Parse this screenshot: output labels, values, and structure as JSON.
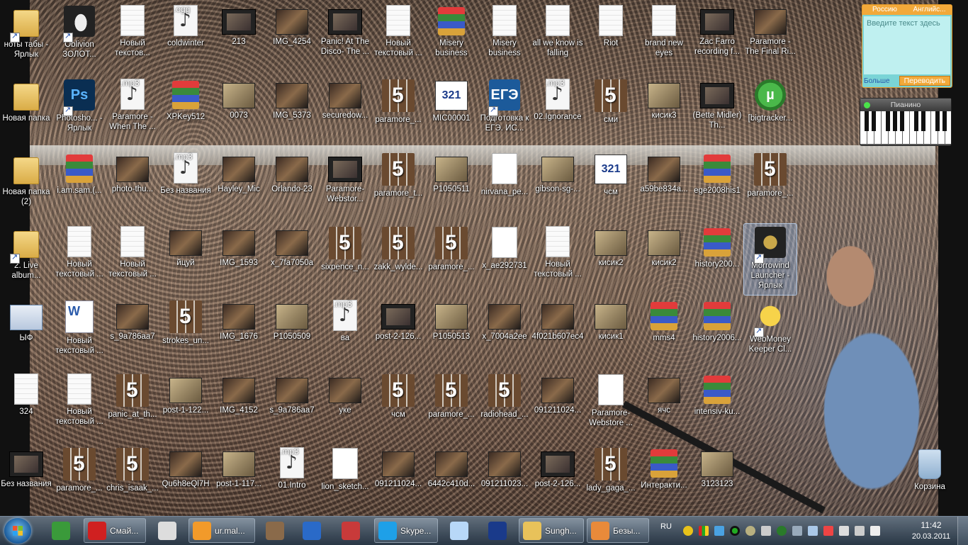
{
  "desktop": {
    "icons": [
      {
        "label": "ноты табы - Ярлык",
        "type": "folder",
        "shortcut": true
      },
      {
        "label": "Oblivion ЗОЛОТ...",
        "type": "obliv",
        "shortcut": true
      },
      {
        "label": "Новый текстов...",
        "type": "doc"
      },
      {
        "label": "coldwinter",
        "type": "mp3",
        "badge": ".ogg"
      },
      {
        "label": "213",
        "type": "vid"
      },
      {
        "label": "IMG_4254",
        "type": "img"
      },
      {
        "label": "Panic! At The Disco- The ...",
        "type": "vid"
      },
      {
        "label": "Новый текстовый ...",
        "type": "doc"
      },
      {
        "label": "Misery business",
        "type": "rar"
      },
      {
        "label": "Misery business",
        "type": "doc"
      },
      {
        "label": "all we know is falling",
        "type": "doc"
      },
      {
        "label": "Riot",
        "type": "doc"
      },
      {
        "label": "brand new eyes",
        "type": "doc"
      },
      {
        "label": "Zac Farro recording f...",
        "type": "vid"
      },
      {
        "label": "Paramore - The Final Ri...",
        "type": "img"
      },
      {
        "label": "Новая папка",
        "type": "folder"
      },
      {
        "label": "Photosho... - Ярлык",
        "type": "ps",
        "shortcut": true
      },
      {
        "label": "Paramore - When The ...",
        "type": "mp3",
        "badge": ".mp3"
      },
      {
        "label": "XPKey512",
        "type": "rar"
      },
      {
        "label": "0073",
        "type": "img2"
      },
      {
        "label": "IMG_5373",
        "type": "img"
      },
      {
        "label": "securedow...",
        "type": "img"
      },
      {
        "label": "paramore_...",
        "type": "five"
      },
      {
        "label": "MIC00001",
        "type": "321"
      },
      {
        "label": "Подготовка к ЕГЭ. ИС...",
        "type": "ege",
        "shortcut": true
      },
      {
        "label": "02.Ignorance",
        "type": "mp3",
        "badge": ".mp3"
      },
      {
        "label": "сми",
        "type": "five"
      },
      {
        "label": "кисик3",
        "type": "img2"
      },
      {
        "label": "(Bette Midler) Th...",
        "type": "vid"
      },
      {
        "label": "[bigtracker...",
        "type": "utor"
      },
      {
        "label": "Новая папка (2)",
        "type": "folder"
      },
      {
        "label": "i.am.sam.(...",
        "type": "rar"
      },
      {
        "label": "photo-thu...",
        "type": "img"
      },
      {
        "label": "Без названия",
        "type": "mp3",
        "badge": ".mp3"
      },
      {
        "label": "Hayley_Mic",
        "type": "img"
      },
      {
        "label": "Orlando-23",
        "type": "img"
      },
      {
        "label": "Paramore- Webstor...",
        "type": "vid"
      },
      {
        "label": "paramore_t...",
        "type": "five"
      },
      {
        "label": "P1050511",
        "type": "img2"
      },
      {
        "label": "nirvana_pe...",
        "type": "lightdoc"
      },
      {
        "label": "gibson-sg-...",
        "type": "img2"
      },
      {
        "label": "чсм",
        "type": "321"
      },
      {
        "label": "a59be834a...",
        "type": "img"
      },
      {
        "label": "ege2008his1",
        "type": "rar"
      },
      {
        "label": "paramore_...",
        "type": "five"
      },
      {
        "label": "2. Live album...",
        "type": "folder",
        "shortcut": true
      },
      {
        "label": "Новый текстовый ...",
        "type": "doc"
      },
      {
        "label": "Новый текстовый ...",
        "type": "doc"
      },
      {
        "label": "йцуй",
        "type": "img"
      },
      {
        "label": "IMG_1593",
        "type": "img"
      },
      {
        "label": "x_7fa7050a",
        "type": "img"
      },
      {
        "label": "sixpence_n...",
        "type": "five"
      },
      {
        "label": "zakk_wylde...",
        "type": "five"
      },
      {
        "label": "paramore_...",
        "type": "five"
      },
      {
        "label": "x_ae292731",
        "type": "lightdoc"
      },
      {
        "label": "Новый текстовый ...",
        "type": "doc"
      },
      {
        "label": "кисик2",
        "type": "img2"
      },
      {
        "label": "кисик2",
        "type": "img2"
      },
      {
        "label": "history200...",
        "type": "rar"
      },
      {
        "label": "Morrowind Launcher - Ярлык",
        "type": "morrow",
        "shortcut": true,
        "selected": true
      },
      {
        "label": "ЫФ",
        "type": "win"
      },
      {
        "label": "Новый текстовый ...",
        "type": "word"
      },
      {
        "label": "s_9a786aa7",
        "type": "img"
      },
      {
        "label": "strokes_un...",
        "type": "five"
      },
      {
        "label": "IMG_1676",
        "type": "img"
      },
      {
        "label": "P1050509",
        "type": "img2"
      },
      {
        "label": "ва",
        "type": "mp3",
        "badge": ".mp3"
      },
      {
        "label": "post-2-126...",
        "type": "vid"
      },
      {
        "label": "P1050513",
        "type": "img2"
      },
      {
        "label": "x_7004a2ee",
        "type": "img"
      },
      {
        "label": "4f021b607ec4",
        "type": "img"
      },
      {
        "label": "кисик1",
        "type": "img2"
      },
      {
        "label": "mms4",
        "type": "rar"
      },
      {
        "label": "history2006...",
        "type": "rar"
      },
      {
        "label": "WebMoney Keeper Cl...",
        "type": "wm",
        "shortcut": true
      },
      {
        "label": "324",
        "type": "doc"
      },
      {
        "label": "Новый текстовый ...",
        "type": "doc"
      },
      {
        "label": "panic_at_th...",
        "type": "five"
      },
      {
        "label": "post-1-122...",
        "type": "img2"
      },
      {
        "label": "IMG_4152",
        "type": "img"
      },
      {
        "label": "s_9a786aa7",
        "type": "img"
      },
      {
        "label": "уке",
        "type": "img"
      },
      {
        "label": "чсм",
        "type": "five"
      },
      {
        "label": "paramore_...",
        "type": "five"
      },
      {
        "label": "radiohead_...",
        "type": "five"
      },
      {
        "label": "091211024...",
        "type": "img"
      },
      {
        "label": "Paramore- Webstore ...",
        "type": "lightdoc"
      },
      {
        "label": "ячс",
        "type": "img"
      },
      {
        "label": "intensiv-ku...",
        "type": "rar"
      },
      {
        "label": "Без названия",
        "type": "vid"
      },
      {
        "label": "paramore_...",
        "type": "five"
      },
      {
        "label": "chris_isaak_...",
        "type": "five"
      },
      {
        "label": "Qu6h8eQl7H",
        "type": "img"
      },
      {
        "label": "post-1-117...",
        "type": "img2"
      },
      {
        "label": "01.Intro",
        "type": "mp3",
        "badge": ".mp3"
      },
      {
        "label": "lion_sketch...",
        "type": "lightdoc"
      },
      {
        "label": "091211024...",
        "type": "img"
      },
      {
        "label": "6442c410d...",
        "type": "img"
      },
      {
        "label": "091211023...",
        "type": "img"
      },
      {
        "label": "post-2-126...",
        "type": "vid"
      },
      {
        "label": "lady_gaga_...",
        "type": "five"
      },
      {
        "label": "Интеракти...",
        "type": "rar"
      },
      {
        "label": "3123123",
        "type": "img2"
      },
      {
        "label": "Корзина",
        "type": "bin"
      }
    ]
  },
  "translator": {
    "from": "Россию",
    "to": "Английс...",
    "placeholder": "Введите текст здесь",
    "more": "Больше",
    "translate": "Переводить"
  },
  "piano": {
    "title": "Пианино"
  },
  "taskbar": {
    "buttons": [
      {
        "label": "",
        "icon": "utorrent-icon",
        "pinned": true,
        "color": "#3a9a3a"
      },
      {
        "label": "Смай...",
        "icon": "opera-icon",
        "color": "#d02020"
      },
      {
        "label": "",
        "icon": "oblivion-icon",
        "pinned": true,
        "color": "#dddddd"
      },
      {
        "label": "ur.mal...",
        "icon": "mail-agent-icon",
        "color": "#f29a2a"
      },
      {
        "label": "",
        "icon": "media-five-icon",
        "pinned": true,
        "color": "#8a6a4a"
      },
      {
        "label": "",
        "icon": "google-earth-icon",
        "pinned": true,
        "color": "#2a6ac8"
      },
      {
        "label": "",
        "icon": "winrar-icon",
        "pinned": true,
        "color": "#c83a3a"
      },
      {
        "label": "Skype...",
        "icon": "skype-icon",
        "color": "#1ea0e8"
      },
      {
        "label": "",
        "icon": "window-icon",
        "pinned": true,
        "color": "#b8d8f8"
      },
      {
        "label": "",
        "icon": "mpc-icon",
        "pinned": true,
        "color": "#1a3a8a"
      },
      {
        "label": "Sungh...",
        "icon": "folder-icon",
        "color": "#e8c25a"
      },
      {
        "label": "Безы...",
        "icon": "paint-icon",
        "color": "#e88a3a"
      }
    ],
    "lang": "RU",
    "time": "11:42",
    "date": "20.03.2011"
  }
}
